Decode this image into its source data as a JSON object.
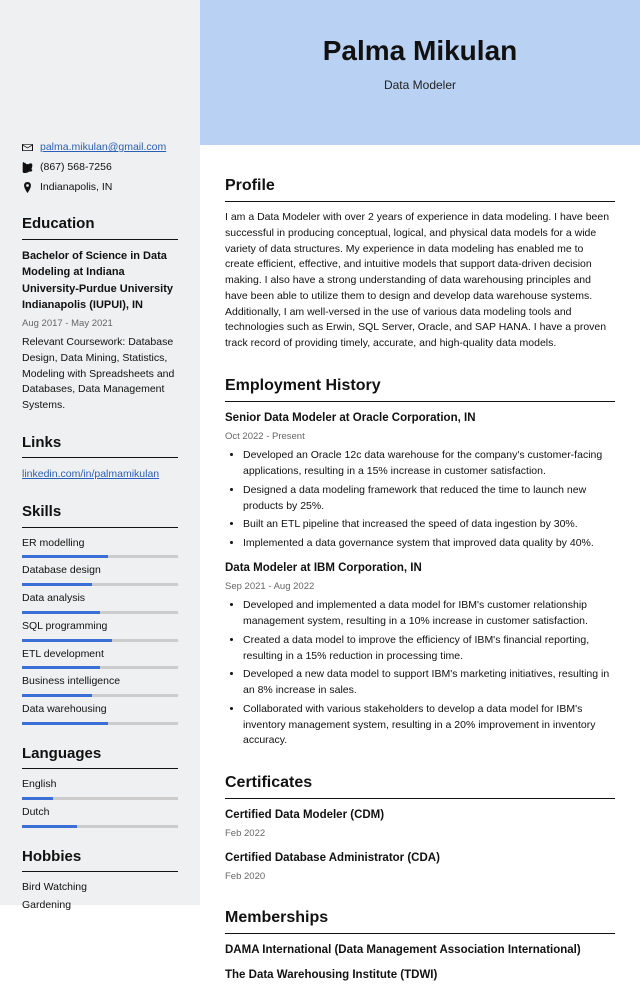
{
  "header": {
    "name": "Palma Mikulan",
    "title": "Data Modeler"
  },
  "contact": {
    "email": "palma.mikulan@gmail.com",
    "phone": "(867) 568-7256",
    "location": "Indianapolis, IN"
  },
  "sidebar": {
    "education_h": "Education",
    "education": {
      "degree": "Bachelor of Science in Data Modeling at Indiana University-Purdue University Indianapolis (IUPUI), IN",
      "dates": "Aug 2017 - May 2021",
      "coursework": "Relevant Coursework: Database Design, Data Mining, Statistics, Modeling with Spreadsheets and Databases, Data Management Systems."
    },
    "links_h": "Links",
    "links": [
      {
        "text": "linkedin.com/in/palmamikulan"
      }
    ],
    "skills_h": "Skills",
    "skills": [
      {
        "name": "ER modelling",
        "pct": 55
      },
      {
        "name": "Database design",
        "pct": 45
      },
      {
        "name": "Data analysis",
        "pct": 50
      },
      {
        "name": "SQL programming",
        "pct": 58
      },
      {
        "name": "ETL development",
        "pct": 50
      },
      {
        "name": "Business intelligence",
        "pct": 45
      },
      {
        "name": "Data warehousing",
        "pct": 55
      }
    ],
    "languages_h": "Languages",
    "languages": [
      {
        "name": "English",
        "pct": 20
      },
      {
        "name": "Dutch",
        "pct": 35
      }
    ],
    "hobbies_h": "Hobbies",
    "hobbies": [
      "Bird Watching",
      "Gardening"
    ]
  },
  "main": {
    "profile_h": "Profile",
    "profile": "I am a Data Modeler with over 2 years of experience in data modeling. I have been successful in producing conceptual, logical, and physical data models for a wide variety of data structures. My experience in data modeling has enabled me to create efficient, effective, and intuitive models that support data-driven decision making. I also have a strong understanding of data warehousing principles and have been able to utilize them to design and develop data warehouse systems. Additionally, I am well-versed in the use of various data modeling tools and technologies such as Erwin, SQL Server, Oracle, and SAP HANA. I have a proven track record of providing timely, accurate, and high-quality data models.",
    "employment_h": "Employment History",
    "jobs": [
      {
        "title": "Senior Data Modeler at Oracle Corporation, IN",
        "dates": "Oct 2022 - Present",
        "bullets": [
          "Developed an Oracle 12c data warehouse for the company's customer-facing applications, resulting in a 15% increase in customer satisfaction.",
          "Designed a data modeling framework that reduced the time to launch new products by 25%.",
          "Built an ETL pipeline that increased the speed of data ingestion by 30%.",
          "Implemented a data governance system that improved data quality by 40%."
        ]
      },
      {
        "title": "Data Modeler at IBM Corporation, IN",
        "dates": "Sep 2021 - Aug 2022",
        "bullets": [
          "Developed and implemented a data model for IBM's customer relationship management system, resulting in a 10% increase in customer satisfaction.",
          "Created a data model to improve the efficiency of IBM's financial reporting, resulting in a 15% reduction in processing time.",
          "Developed a new data model to support IBM's marketing initiatives, resulting in an 8% increase in sales.",
          "Collaborated with various stakeholders to develop a data model for IBM's inventory management system, resulting in a 20% improvement in inventory accuracy."
        ]
      }
    ],
    "certificates_h": "Certificates",
    "certificates": [
      {
        "title": "Certified Data Modeler (CDM)",
        "dates": "Feb 2022"
      },
      {
        "title": "Certified Database Administrator (CDA)",
        "dates": "Feb 2020"
      }
    ],
    "memberships_h": "Memberships",
    "memberships": [
      "DAMA International (Data Management Association International)",
      "The Data Warehousing Institute (TDWI)"
    ]
  }
}
